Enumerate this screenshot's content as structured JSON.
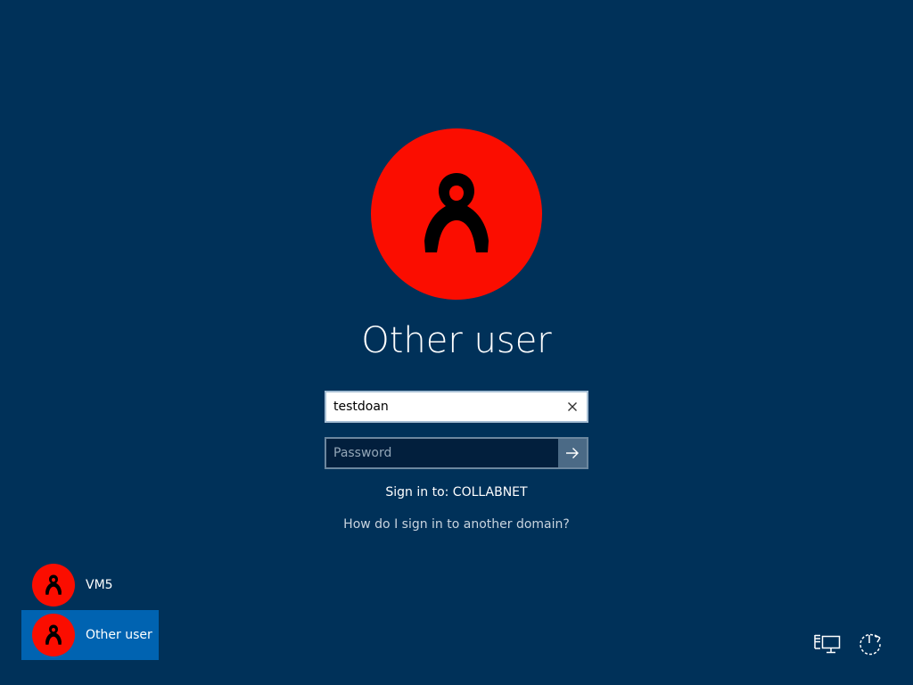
{
  "colors": {
    "background": "#003159",
    "avatar": "#fb0d00",
    "selected_tile": "#0063b1",
    "submit_button": "#4b6a86"
  },
  "main_user": {
    "name": "Other user",
    "avatar_icon": "user-silhouette-icon"
  },
  "form": {
    "username_value": "testdoan",
    "clear_icon": "close-icon",
    "password_placeholder": "Password",
    "submit_icon": "arrow-right-icon",
    "signin_to": "Sign in to: COLLABNET",
    "domain_help": "How do I sign in to another domain?"
  },
  "user_list": [
    {
      "name": "VM5",
      "selected": false
    },
    {
      "name": "Other user",
      "selected": true
    }
  ],
  "corner_icons": {
    "network": "network-icon",
    "power": "power-icon"
  }
}
